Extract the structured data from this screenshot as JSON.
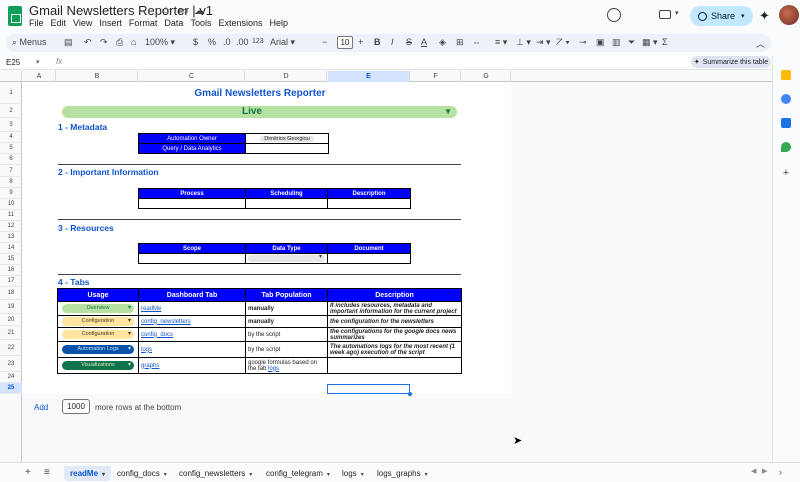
{
  "app": {
    "title": "Gmail Newsletters Reporter | v1",
    "menu": [
      "File",
      "Edit",
      "View",
      "Insert",
      "Format",
      "Data",
      "Tools",
      "Extensions",
      "Help"
    ],
    "share_label": "Share"
  },
  "toolbar": {
    "menus_label": "Menus",
    "zoom": "100%",
    "currency": "$",
    "percent": "%",
    "decimals_dec": ".0",
    "decimals_inc": ".00",
    "number_format": "123",
    "font": "Arial",
    "font_size": "10",
    "bold": "B",
    "italic": "I",
    "strike": "S",
    "text_color": "A"
  },
  "formula_bar": {
    "name_box": "E25",
    "fx": "fx",
    "summarize_label": "Summarize this table"
  },
  "grid": {
    "columns": [
      "A",
      "B",
      "C",
      "D",
      "E",
      "F",
      "G"
    ],
    "selected_column": "E",
    "rows": [
      "1",
      "2",
      "3",
      "4",
      "5",
      "6",
      "7",
      "8",
      "9",
      "10",
      "11",
      "12",
      "13",
      "14",
      "15",
      "16",
      "17",
      "18",
      "19",
      "20",
      "21",
      "22",
      "23",
      "24",
      "25"
    ],
    "selected_row": "25"
  },
  "sheet": {
    "title": "Gmail Newsletters Reporter",
    "status": "Live",
    "section1": "1 - Metadata",
    "metadata": [
      {
        "key": "Automation Owner",
        "value": "Dimitrios Georgiou"
      },
      {
        "key": "Query / Data Analytics",
        "value": ""
      }
    ],
    "section2": "2 - Important Information",
    "info_headers": [
      "Process",
      "Scheduling",
      "Description"
    ],
    "section3": "3 - Resources",
    "resources_headers": [
      "Scope",
      "Data Type",
      "Document"
    ],
    "section4": "4 - Tabs",
    "tabs_headers": [
      "Usage",
      "Dashboard Tab",
      "Tab Population",
      "Description"
    ],
    "tabs_rows": [
      {
        "usage": "Overview",
        "tab": "readMe",
        "population": "manually",
        "population_bold": true,
        "description": "It includes resources, metadata and important information for the current project"
      },
      {
        "usage": "Configuration",
        "tab": "config_newsletters",
        "population": "manually",
        "population_bold": true,
        "description": "the configuration for the newsletters"
      },
      {
        "usage": "Configuration",
        "tab": "config_docs",
        "population": "by the script",
        "population_bold": false,
        "description": "the configurations for the google docs news summarizes"
      },
      {
        "usage": "Automation Logs",
        "tab": "logs",
        "population": "by the script",
        "population_bold": false,
        "description": "The automations logs for the most recent (1 week ago) execution of the script"
      },
      {
        "usage": "Visualizations",
        "tab": "graphs",
        "population": "google formulas based on the tab",
        "population_link": "logs",
        "population_bold": false,
        "description": ""
      }
    ]
  },
  "footer": {
    "add_label": "Add",
    "rows_value": "1000",
    "rows_suffix": "more rows at the bottom"
  },
  "sheet_tabs": [
    {
      "label": "readMe",
      "active": true
    },
    {
      "label": "config_docs",
      "active": false
    },
    {
      "label": "config_newsletters",
      "active": false
    },
    {
      "label": "config_telegram",
      "active": false
    },
    {
      "label": "logs",
      "active": false
    },
    {
      "label": "logs_graphs",
      "active": false
    }
  ],
  "colors": {
    "header_blue": "#0000ff",
    "title_blue": "#1155cc",
    "live_green": "#b7e1a1",
    "selection": "#1a73e8"
  }
}
